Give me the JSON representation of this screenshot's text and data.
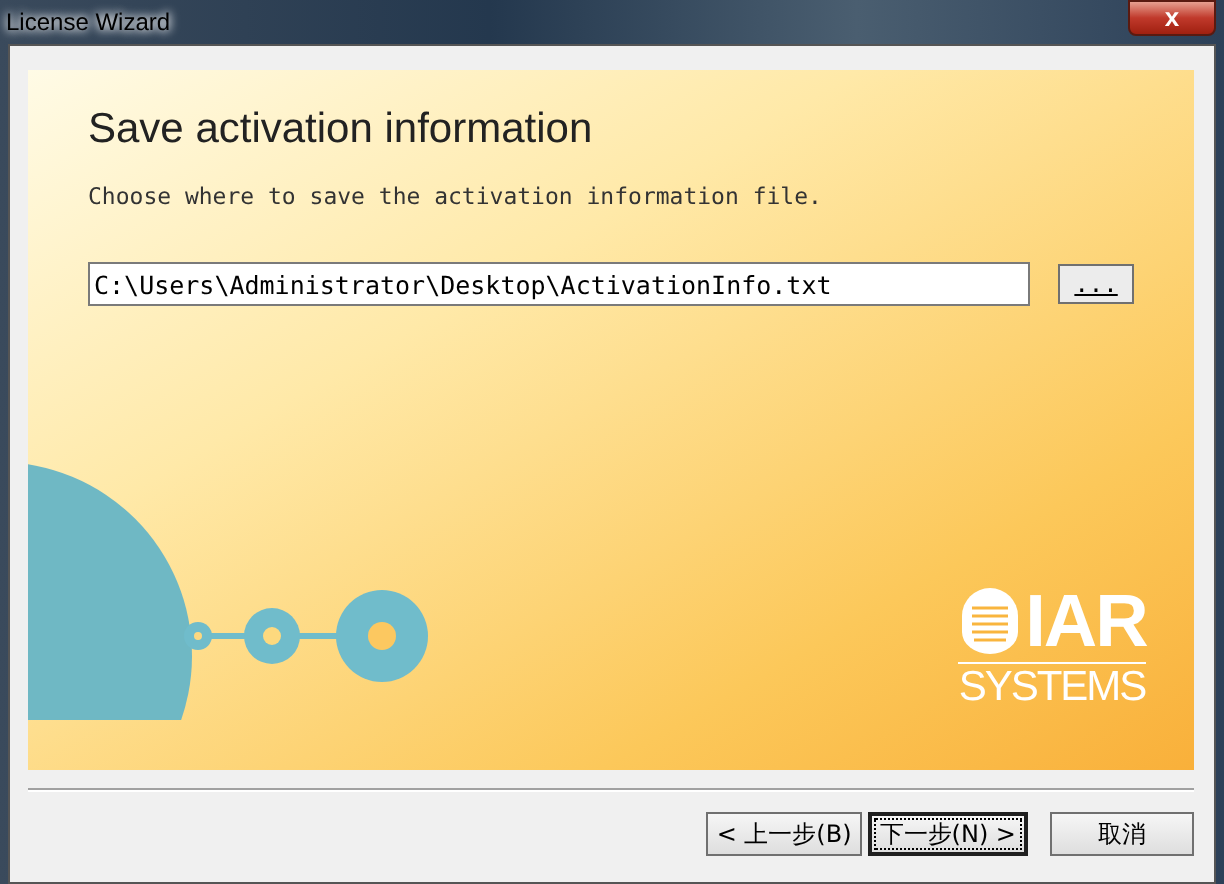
{
  "window": {
    "title": "License Wizard",
    "close_label": "x"
  },
  "page": {
    "heading": "Save activation information",
    "instruction": "Choose where to save the activation information file.",
    "path_field": {
      "value": "C:\\Users\\Administrator\\Desktop\\ActivationInfo.txt"
    },
    "browse_button": "..."
  },
  "logo": {
    "brand": "IAR",
    "subtitle": "SYSTEMS"
  },
  "buttons": [
    {
      "label": "< 上一步(B)",
      "default": false
    },
    {
      "label": "下一步(N) >",
      "default": true
    },
    {
      "label": "取消",
      "default": false
    }
  ]
}
